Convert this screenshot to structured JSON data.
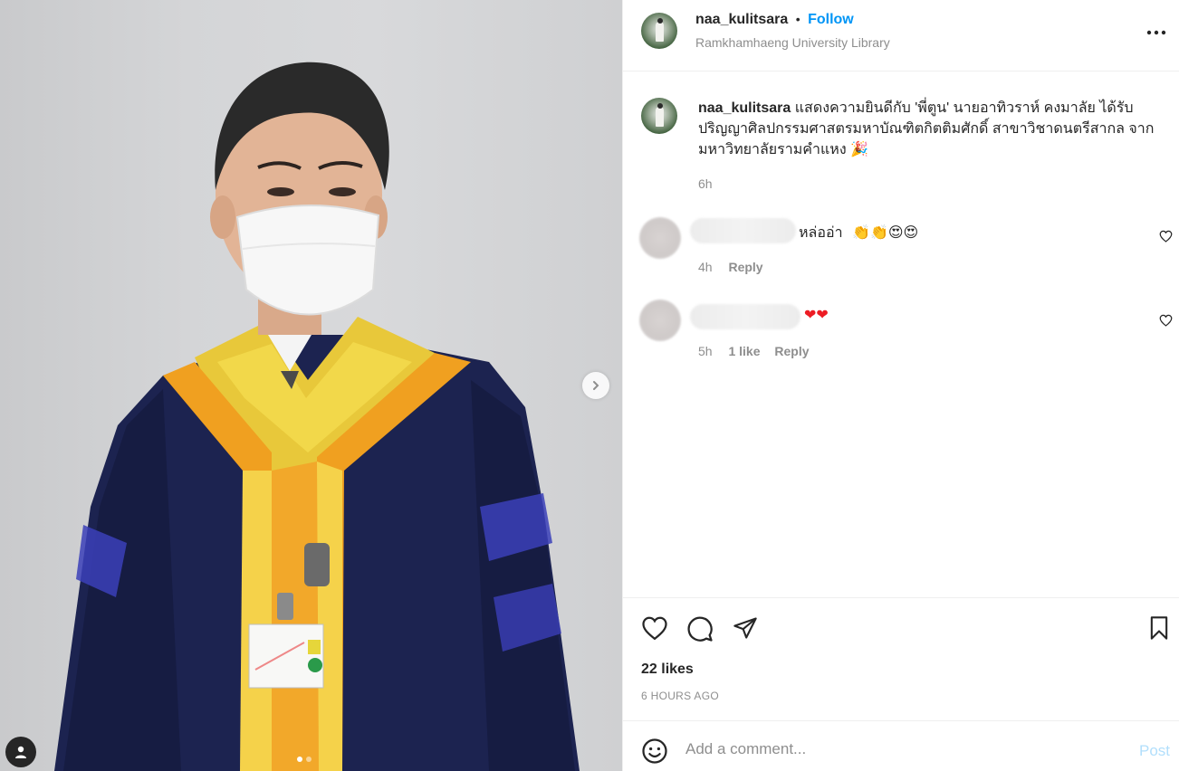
{
  "post": {
    "username": "naa_kulitsara",
    "bullet": "•",
    "follow_label": "Follow",
    "location": "Ramkhamhaeng University Library",
    "more_icon": "more-horizontal-icon"
  },
  "caption": {
    "username": "naa_kulitsara",
    "text": "แสดงความยินดีกับ 'พี่ตูน' นายอาทิวราห์ คงมาลัย ได้รับปริญญาศิลปกรรมศาสตรมหาบัณฑิตกิตติมศักดิ์ สาขาวิชาดนตรีสากล จากมหาวิทยาลัยรามคำแหง",
    "emoji": "🎉",
    "time": "6h"
  },
  "comments": [
    {
      "text": "หล่ออ่า",
      "emojis": "👏👏😍😍",
      "time": "4h",
      "reply_label": "Reply"
    },
    {
      "text": "",
      "emojis": "❤❤",
      "time": "5h",
      "likes_label": "1 like",
      "reply_label": "Reply"
    }
  ],
  "engagement": {
    "likes": "22 likes",
    "posted_ago": "6 HOURS AGO"
  },
  "composer": {
    "placeholder": "Add a comment...",
    "post_label": "Post"
  },
  "colors": {
    "accent": "#0095f6",
    "post_disabled": "#b2dffc",
    "muted": "#8e8e8e",
    "gown_navy": "#1c2350",
    "hood_gold": "#e8c83a",
    "hood_orange": "#f0a020"
  }
}
